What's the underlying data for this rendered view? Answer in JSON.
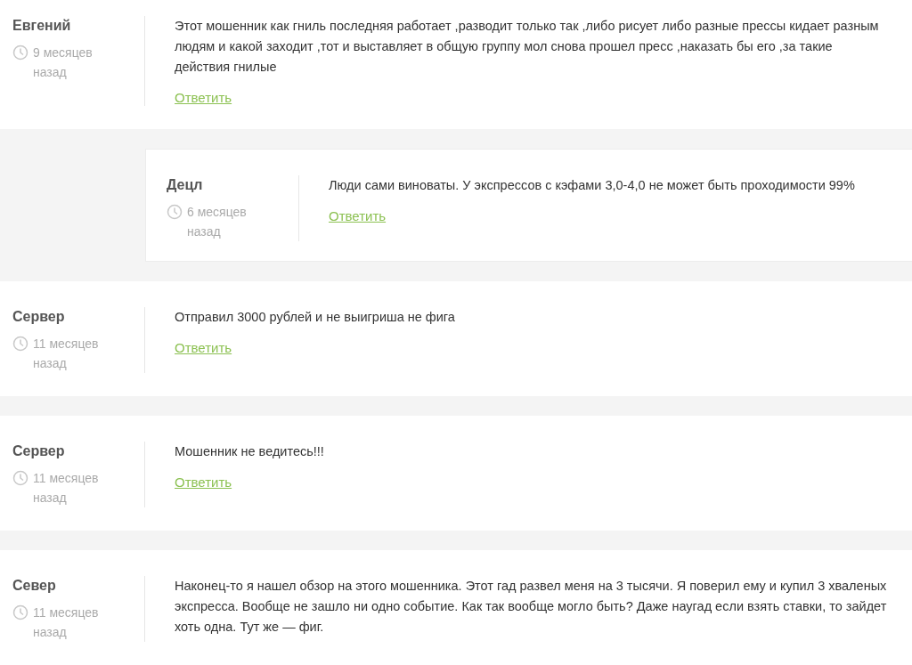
{
  "comments": [
    {
      "author": "Евгений",
      "time": "9 месяцев назад",
      "text": "Этот мошенник как гниль последняя работает ,разводит только так ,либо рисует либо разные прессы кидает разным людям и какой заходит ,тот и выставляет в общую группу мол снова прошел пресс ,наказать бы его ,за такие действия гнилые",
      "reply_label": "Ответить",
      "children": [
        {
          "author": "Децл",
          "time": "6 месяцев назад",
          "text": "Люди сами виноваты. У экспрессов с кэфами 3,0-4,0 не может быть проходимости 99%",
          "reply_label": "Ответить"
        }
      ]
    },
    {
      "author": "Сервер",
      "time": "11 месяцев назад",
      "text": "Отправил 3000 рублей и не выигриша не фига",
      "reply_label": "Ответить"
    },
    {
      "author": "Сервер",
      "time": "11 месяцев назад",
      "text": "Мошенник не ведитесь!!!",
      "reply_label": "Ответить"
    },
    {
      "author": "Север",
      "time": "11 месяцев назад",
      "text": "Наконец-то я нашел обзор на этого мошенника. Этот гад развел меня на 3 тысячи. Я поверил ему и купил 3 хваленых экспресса. Вообще не зашло ни одно событие. Как так вообще могло быть? Даже наугад если взять ставки, то зайдет хоть одна. Тут же — фиг."
    }
  ]
}
